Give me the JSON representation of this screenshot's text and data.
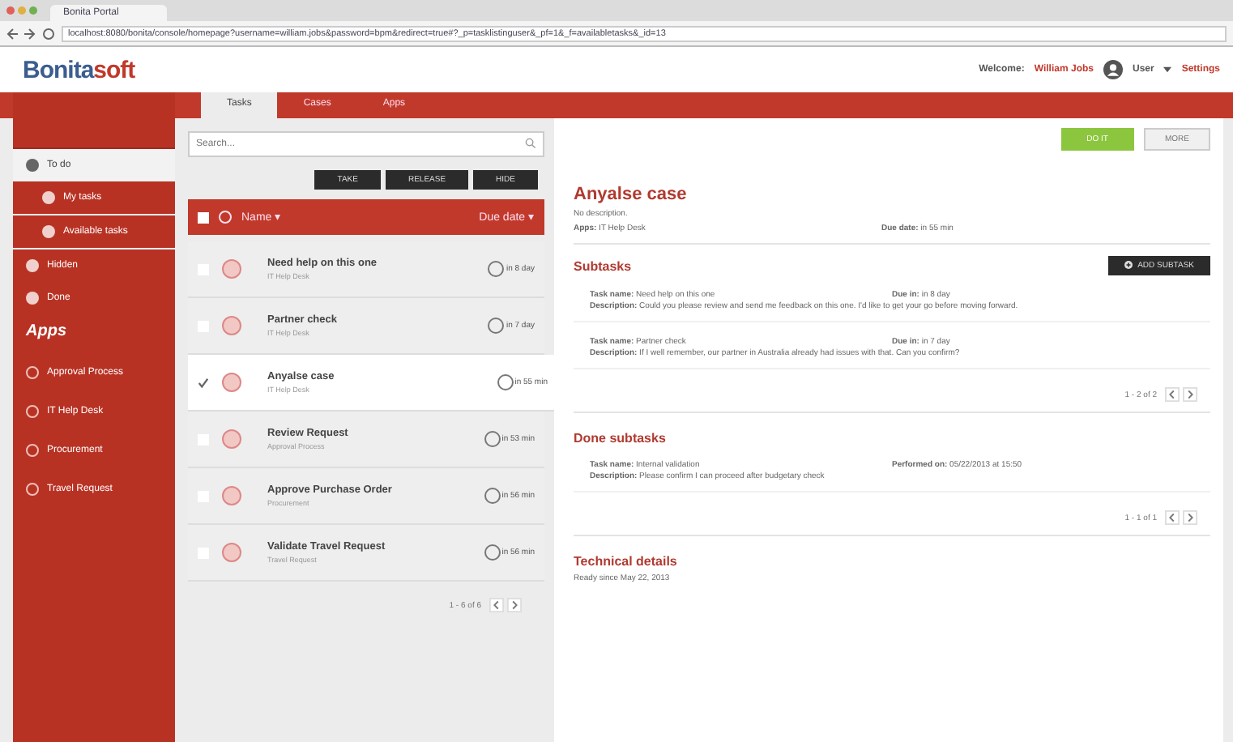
{
  "browser": {
    "tab_title": "Bonita Portal",
    "url": "localhost:8080/bonita/console/homepage?username=william.jobs&password=bpm&redirect=true#?_p=tasklistinguser&_pf=1&_f=availabletasks&_id=13"
  },
  "header": {
    "logo_main": "Bonita",
    "logo_accent": "soft",
    "welcome": "Welcome:",
    "user_name": "William Jobs",
    "profile": "User",
    "settings": "Settings"
  },
  "tabs": [
    {
      "label": "Tasks",
      "selected": true
    },
    {
      "label": "Cases",
      "selected": false
    },
    {
      "label": "Apps",
      "selected": false
    }
  ],
  "sidebar": {
    "items": [
      {
        "label": "To do",
        "selected": true,
        "children": [
          {
            "label": "My tasks",
            "selected": false
          },
          {
            "label": "Available tasks",
            "selected": false
          }
        ]
      },
      {
        "label": "Hidden",
        "selected": false
      },
      {
        "label": "Done",
        "selected": false
      }
    ],
    "apps_heading": "Apps",
    "apps": [
      {
        "label": "Approval Process",
        "selected": false
      },
      {
        "label": "IT Help Desk",
        "selected": false
      },
      {
        "label": "Procurement",
        "selected": false
      },
      {
        "label": "Travel Request",
        "selected": false
      }
    ]
  },
  "search": {
    "placeholder": "Search..."
  },
  "actions": [
    "TAKE",
    "RELEASE",
    "HIDE"
  ],
  "list": {
    "select_all_checked": false,
    "name_column": "Name ▾",
    "due_column": "Due date ▾",
    "pager": "1 - 6 of 6",
    "rows": [
      {
        "name": "Need help on this one",
        "app": "IT Help Desk",
        "due": "in 8 day",
        "checked": false,
        "selected": false
      },
      {
        "name": "Partner check",
        "app": "IT Help Desk",
        "due": "in 7 day",
        "checked": false,
        "selected": false
      },
      {
        "name": "Anyalse case",
        "app": "IT Help Desk",
        "due": "in 55 min",
        "checked": true,
        "selected": true
      },
      {
        "name": "Review Request",
        "app": "Approval Process",
        "due": "in 53 min",
        "checked": false,
        "selected": false
      },
      {
        "name": "Approve Purchase Order",
        "app": "Procurement",
        "due": "in 56 min",
        "checked": false,
        "selected": false
      },
      {
        "name": "Validate Travel Request",
        "app": "Travel Request",
        "due": "in 56 min",
        "checked": false,
        "selected": false
      }
    ]
  },
  "detail": {
    "do_it": "DO IT",
    "more": "MORE",
    "title": "Anyalse case",
    "description": "No description.",
    "app": "**Apps:** IT Help Desk",
    "due": "**Due date:** in 55 min",
    "subtasks_title": "Subtasks",
    "add_subtask": "ADD SUBTASK",
    "subtasks": [
      {
        "name": "**Task name:** Need help on this one",
        "date": "**Due in:** in 8 day",
        "description": "**Description:** Could you please review and send me feedback on this one. I'd like to get your go before moving forward."
      },
      {
        "name": "**Task name:** Partner check",
        "date": "**Due in:** in 7 day",
        "description": "**Description:** If I well remember, our partner in Australia already had issues with that. Can you confirm?"
      }
    ],
    "subtasks_pager": "1 - 2 of 2",
    "done_title": "Done subtasks",
    "done": [
      {
        "name": "**Task name:** Internal validation",
        "date": "**Performed on:** 05/22/2013 at 15:50",
        "description": "**Description:** Please confirm I can proceed after budgetary check"
      }
    ],
    "done_pager": "1 - 1 of 1",
    "technical_title": "Technical details",
    "technical_text": "Ready since May 22, 2013"
  }
}
